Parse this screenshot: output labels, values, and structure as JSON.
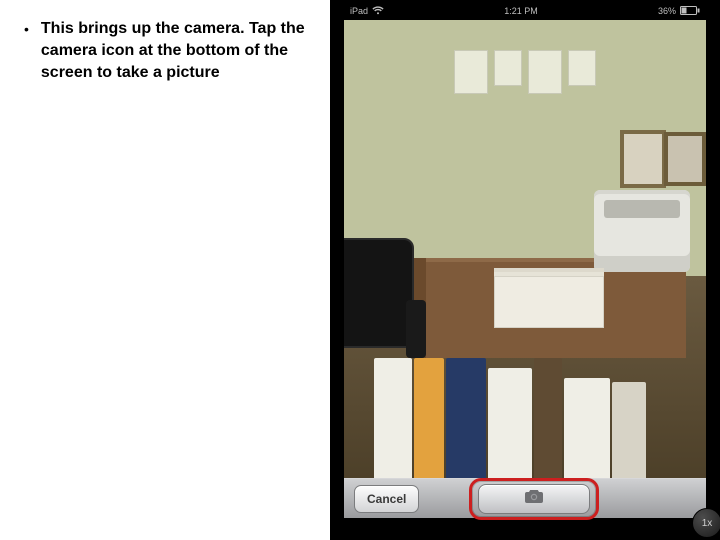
{
  "instruction": {
    "bullet_glyph": "•",
    "text": "This brings up the camera. Tap the camera icon at the bottom of the screen to take a picture"
  },
  "status_bar": {
    "device_label": "iPad",
    "time": "1:21 PM",
    "battery_percent": "36%"
  },
  "toolbar": {
    "cancel_label": "Cancel"
  },
  "zoom": {
    "label": "1x"
  }
}
